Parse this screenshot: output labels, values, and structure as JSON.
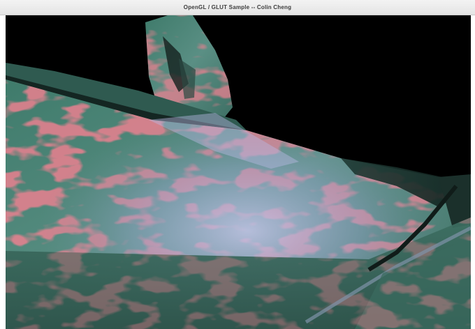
{
  "window": {
    "title": "OpenGL / GLUT Sample -- Colin Cheng"
  },
  "scene": {
    "background_color": "#000000",
    "surface_base_color": "#4f8a7a",
    "pattern_color": "#d23c4a",
    "highlight_color": "#a9b4d8"
  }
}
